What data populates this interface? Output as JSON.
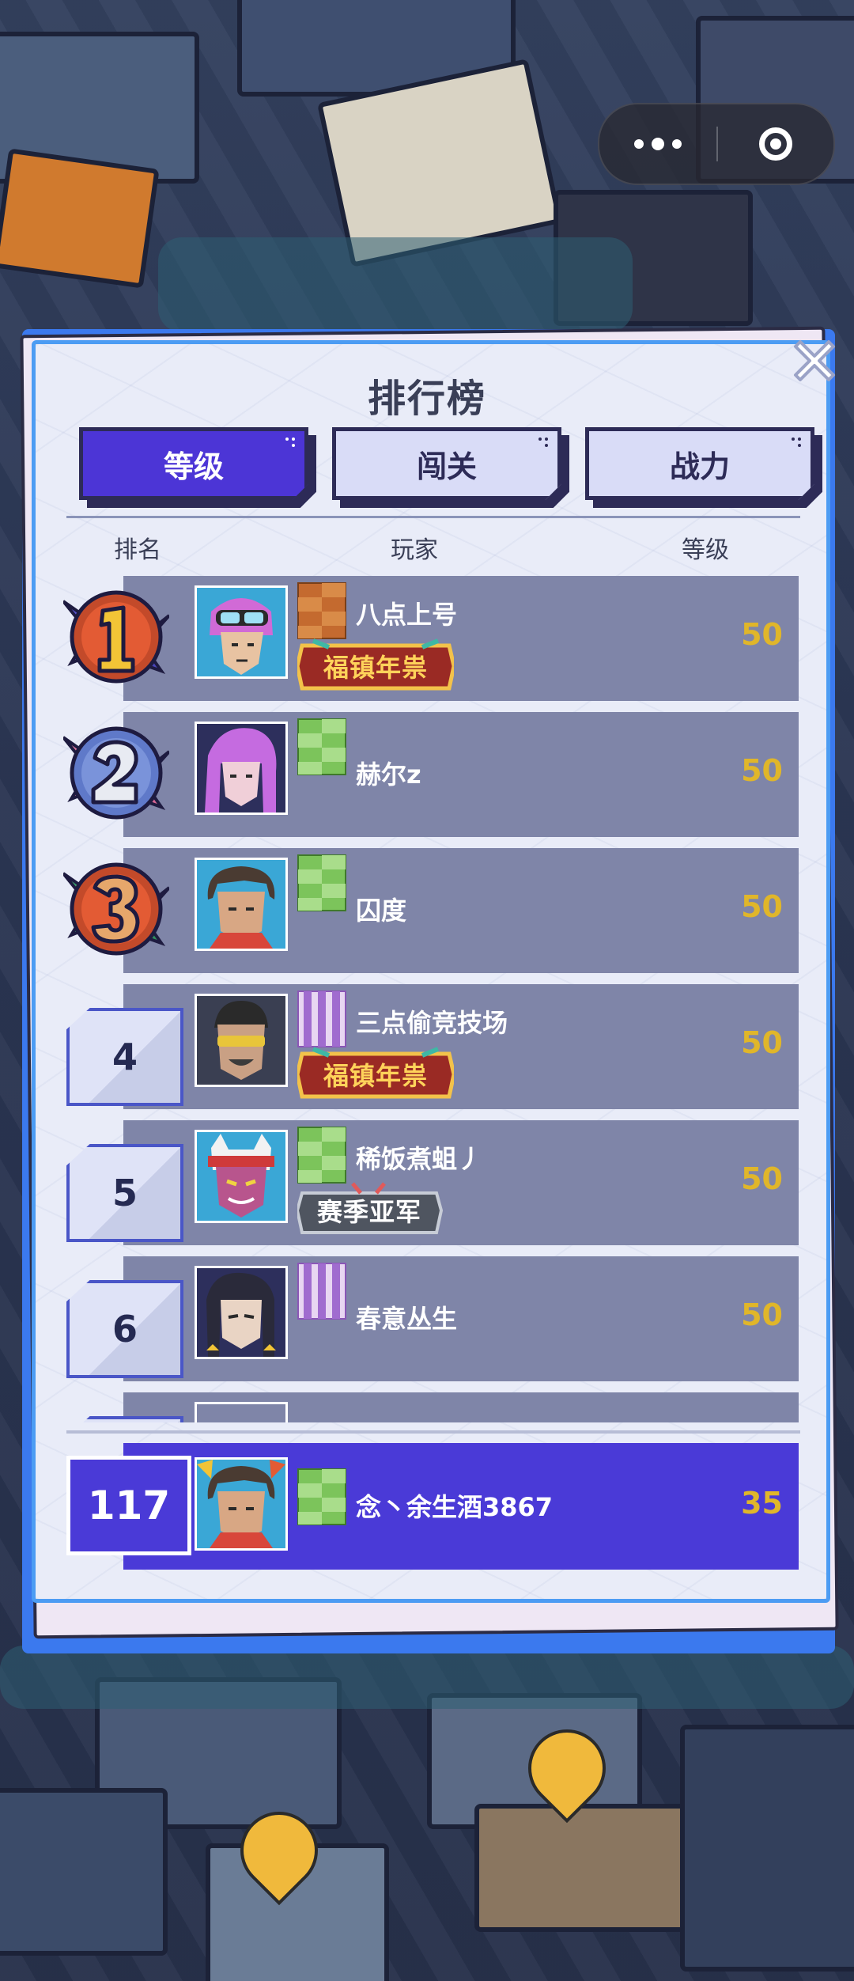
{
  "capsule": {
    "more_icon": "more-dots-icon",
    "close_icon": "target-circle-icon"
  },
  "panel": {
    "title": "排行榜",
    "close_icon": "close-x-icon",
    "tabs": [
      {
        "label": "等级",
        "active": true
      },
      {
        "label": "闯关",
        "active": false
      },
      {
        "label": "战力",
        "active": false
      }
    ],
    "columns": {
      "rank": "排名",
      "player": "玩家",
      "level": "等级"
    }
  },
  "rows": [
    {
      "rank": "1",
      "name": "八点上号",
      "level": "50",
      "tier": "bronze",
      "badge": "福镇年祟",
      "avatar_hair": "#d16ad6"
    },
    {
      "rank": "2",
      "name": "赫尔z",
      "level": "50",
      "tier": "green",
      "badge": "",
      "avatar_hair": "#c56be0"
    },
    {
      "rank": "3",
      "name": "囚度",
      "level": "50",
      "tier": "green",
      "badge": "",
      "avatar_hair": "#4a3b32"
    },
    {
      "rank": "4",
      "name": "三点偷竞技场",
      "level": "50",
      "tier": "purple",
      "badge": "福镇年祟",
      "avatar_hair": "#2a2a2a"
    },
    {
      "rank": "5",
      "name": "稀饭煮蛆丿",
      "level": "50",
      "tier": "green",
      "badge": "赛季亚军",
      "avatar_hair": "#cf3a3a"
    },
    {
      "rank": "6",
      "name": "春意丛生",
      "level": "50",
      "tier": "purple",
      "badge": "",
      "avatar_hair": "#2a2a3a"
    }
  ],
  "me": {
    "rank": "117",
    "name": "念丶余生酒3867",
    "level": "35",
    "tier": "green"
  },
  "colors": {
    "active_tab": "#4c35d6",
    "inactive_tab": "#d9dcf7",
    "row_bar": "#7f85a8",
    "me_bar": "#4a3ad7",
    "level_text": "#e0b62a"
  }
}
